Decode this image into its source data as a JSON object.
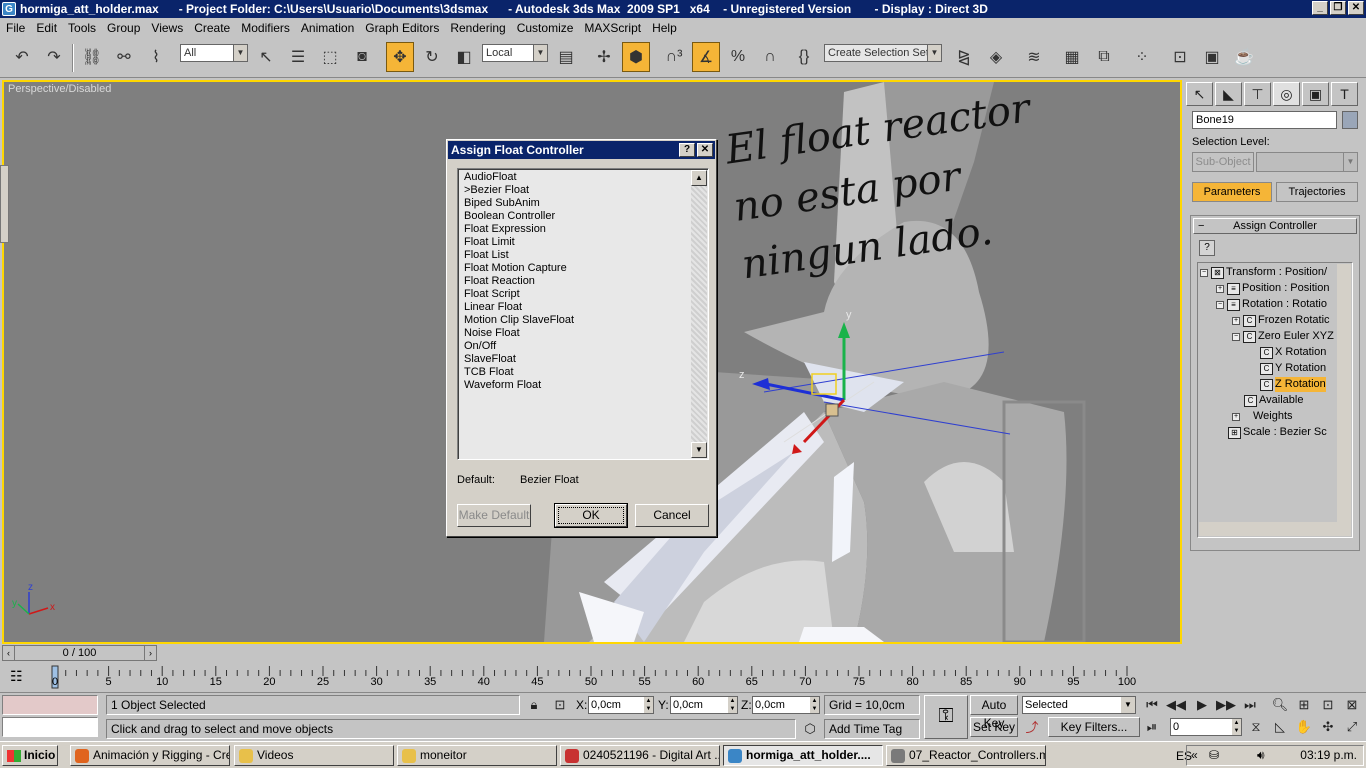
{
  "window": {
    "title": "hormiga_att_holder.max      - Project Folder: C:\\Users\\Usuario\\Documents\\3dsmax      - Autodesk 3ds Max  2009 SP1   x64    - Unregistered Version       - Display : Direct 3D",
    "controls": [
      "_",
      "❐",
      "✕"
    ]
  },
  "menu": [
    "File",
    "Edit",
    "Tools",
    "Group",
    "Views",
    "Create",
    "Modifiers",
    "Animation",
    "Graph Editors",
    "Rendering",
    "Customize",
    "MAXScript",
    "Help"
  ],
  "toolbar": {
    "selection_filter": "All",
    "reference_coord": "Local",
    "named_selection_placeholder": "Create Selection Set",
    "icons": [
      "undo-icon",
      "redo-icon",
      "link-icon",
      "unlink-icon",
      "bind-space-warp-icon",
      "select-icon",
      "select-by-name-icon",
      "rect-region-icon",
      "window-crossing-icon",
      "move-icon",
      "rotate-icon",
      "scale-icon",
      "pivot-icon",
      "manipulate-icon",
      "keyboard-shortcut-icon",
      "snaps-icon",
      "angle-snap-icon",
      "percent-snap-icon",
      "spinner-snap-icon",
      "edit-named-sets-icon",
      "mirror-icon",
      "align-icon",
      "layer-manager-icon",
      "curve-editor-icon",
      "schematic-view-icon",
      "material-editor-icon",
      "render-setup-icon",
      "rendered-frame-icon",
      "render-icon"
    ],
    "active_tools": [
      "move",
      "manipulate",
      "snaps"
    ]
  },
  "viewport": {
    "label": "Perspective/Disabled",
    "handwritten_note": "El float reactor no esta por ningun lado.",
    "axis": {
      "x": "x",
      "y": "y",
      "z": "z"
    }
  },
  "dialog": {
    "title": "Assign Float Controller",
    "help": "?",
    "close": "✕",
    "items": [
      "AudioFloat",
      ">Bezier Float",
      "Biped SubAnim",
      "Boolean Controller",
      "Float Expression",
      "Float Limit",
      "Float List",
      "Float Motion Capture",
      "Float Reaction",
      "Float Script",
      "Linear Float",
      "Motion Clip SlaveFloat",
      "Noise Float",
      "On/Off",
      "SlaveFloat",
      "TCB Float",
      "Waveform Float"
    ],
    "default_label": "Default:",
    "default_value": "Bezier Float",
    "make_default": "Make Default",
    "ok": "OK",
    "cancel": "Cancel"
  },
  "command_panel": {
    "tabs": [
      "create-icon",
      "modify-icon",
      "hierarchy-icon",
      "motion-icon",
      "display-icon",
      "utilities-icon"
    ],
    "tab_glyphs": [
      "↖",
      "◣",
      "⊤",
      "◎",
      "▣",
      "T"
    ],
    "active_tab": 3,
    "object_name": "Bone19",
    "selection_level_label": "Selection Level:",
    "sub_object": "Sub-Object",
    "parameters": "Parameters",
    "trajectories": "Trajectories",
    "rollout_title": "Assign Controller",
    "rollout_help": "?",
    "tree": [
      {
        "label": "Transform : Position/",
        "icon": "⊠",
        "toggle": "−"
      },
      {
        "label": "Position : Position",
        "icon": "≡",
        "toggle": "+"
      },
      {
        "label": "Rotation : Rotatio",
        "icon": "≡",
        "toggle": "−"
      },
      {
        "label": "Frozen Rotatic",
        "icon": "C",
        "toggle": "+"
      },
      {
        "label": "Zero Euler XYZ",
        "icon": "C",
        "toggle": "−"
      },
      {
        "label": "X Rotation",
        "icon": "C",
        "toggle": ""
      },
      {
        "label": "Y Rotation",
        "icon": "C",
        "toggle": ""
      },
      {
        "label": "Z Rotation",
        "icon": "C",
        "toggle": ""
      },
      {
        "label": "Available",
        "icon": "C",
        "toggle": ""
      },
      {
        "label": "Weights",
        "icon": "",
        "toggle": "+"
      },
      {
        "label": "Scale : Bezier Sc",
        "icon": "⊞",
        "toggle": ""
      }
    ],
    "selected_tree_item": "Z Rotation"
  },
  "timeline": {
    "frame_display": "0 / 100",
    "ticks": [
      "0",
      "5",
      "10",
      "15",
      "20",
      "25",
      "30",
      "35",
      "40",
      "45",
      "50",
      "55",
      "60",
      "65",
      "70",
      "75",
      "80",
      "85",
      "90",
      "95",
      "100"
    ]
  },
  "status": {
    "selection": "1 Object Selected",
    "prompt": "Click and drag to select and move objects",
    "x_label": "X:",
    "x_value": "0,0cm",
    "y_label": "Y:",
    "y_value": "0,0cm",
    "z_label": "Z:",
    "z_value": "0,0cm",
    "grid": "Grid = 10,0cm",
    "add_time_tag": "Add Time Tag",
    "auto_key": "Auto Key",
    "set_key": "Set Key",
    "key_mode": "Selected",
    "key_filters": "Key Filters...",
    "frame": "0"
  },
  "taskbar": {
    "start": "Inicio",
    "tasks": [
      {
        "label": "Animación y Rigging - Cre...",
        "color": "#e0641e",
        "active": false
      },
      {
        "label": "Videos",
        "color": "#e8c04a",
        "active": false
      },
      {
        "label": "moneitor",
        "color": "#e8c04a",
        "active": false
      },
      {
        "label": "0240521196 - Digital Art ...",
        "color": "#c83232",
        "active": false
      },
      {
        "label": "hormiga_att_holder....",
        "color": "#3b86c6",
        "active": true
      },
      {
        "label": "07_Reactor_Controllers.m...",
        "color": "#7a7a7a",
        "active": false
      }
    ],
    "lang": "ES",
    "clock": "03:19 p.m."
  }
}
